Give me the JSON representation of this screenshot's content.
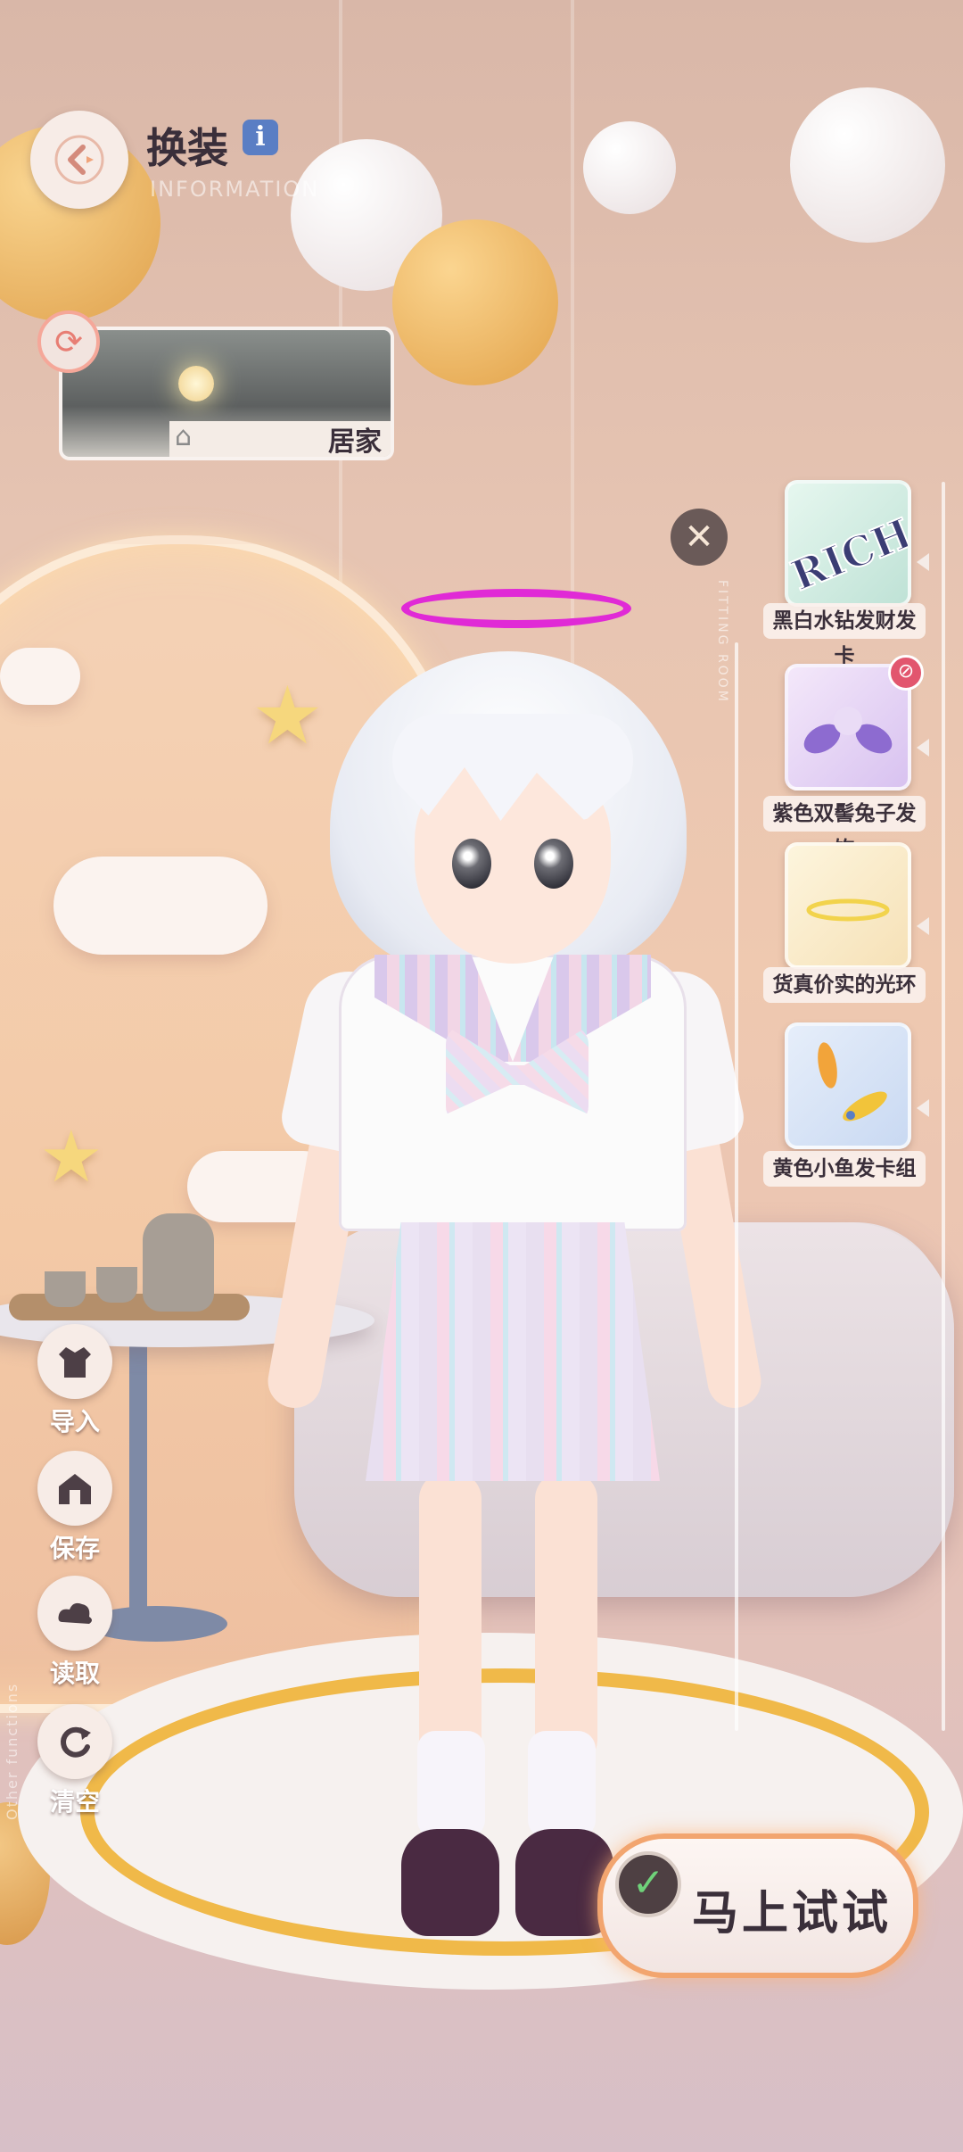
{
  "header": {
    "title": "换装",
    "subtitle": "INFORMATION",
    "info_icon": "i"
  },
  "scene": {
    "label": "居家"
  },
  "fitting_room": {
    "label": "FITTING ROOM"
  },
  "items": [
    {
      "name": "黑白水钻发财发卡",
      "card_text": "RICH",
      "icon": "rich-hairclip-icon"
    },
    {
      "name": "紫色双髻兔子发饰",
      "icon": "purple-bunny-hair-ornament-icon",
      "badge": "forbidden"
    },
    {
      "name": "货真价实的光环",
      "icon": "halo-icon"
    },
    {
      "name": "黄色小鱼发卡组",
      "icon": "yellow-fish-hairclip-icon"
    }
  ],
  "tools": [
    {
      "label": "导入",
      "icon": "import-outfit-icon"
    },
    {
      "label": "保存",
      "icon": "save-icon"
    },
    {
      "label": "读取",
      "icon": "load-icon"
    },
    {
      "label": "清空",
      "icon": "clear-icon"
    }
  ],
  "other_functions_label": "Other functions",
  "try_button": {
    "label": "马上试试"
  },
  "colors": {
    "accent": "#f2a56f",
    "halo": "#e02ad6",
    "badge": "#e2566e",
    "check": "#6fd27a"
  }
}
